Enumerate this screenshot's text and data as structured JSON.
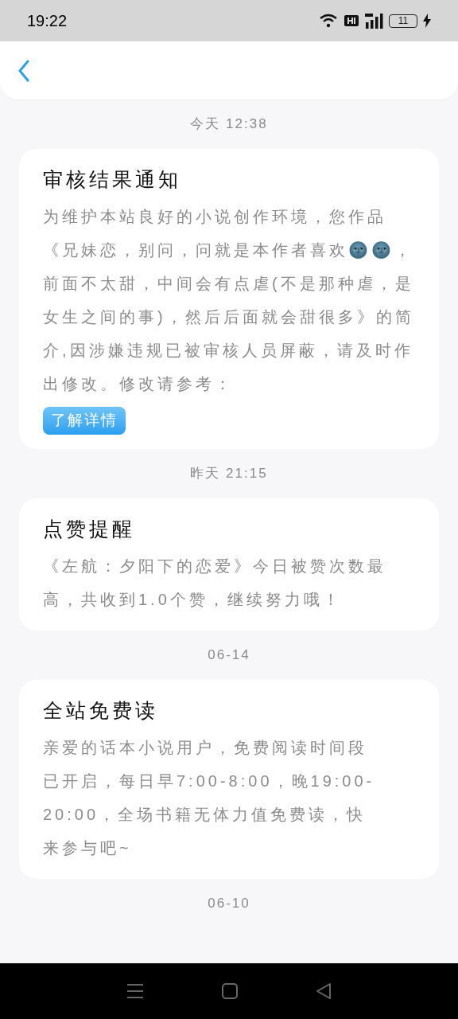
{
  "status_bar": {
    "time": "19:22",
    "battery": "11"
  },
  "messages": [
    {
      "time": "今天 12:38",
      "title": "审核结果通知",
      "body": "为维护本站良好的小说创作环境，您作品《兄妹恋，别问，问就是本作者喜欢🌚🌚，前面不太甜，中间会有点虐(不是那种虐，是女生之间的事)，然后后面就会甜很多》的简介,因涉嫌违规已被审核人员屏蔽，请及时作出修改。修改请参考：",
      "button": "了解详情"
    },
    {
      "time": "昨天 21:15",
      "title": "点赞提醒",
      "body": "《左航：夕阳下的恋爱》今日被赞次数最高，共收到1.0个赞，继续努力哦！"
    },
    {
      "time": "06-14",
      "title": "全站免费读",
      "body": "亲爱的话本小说用户，免费阅读时间段已开启，每日早7:00-8:00，晚19:00-20:00，全场书籍无体力值免费读，快来参与吧~"
    }
  ],
  "trailing_time": "06-10"
}
